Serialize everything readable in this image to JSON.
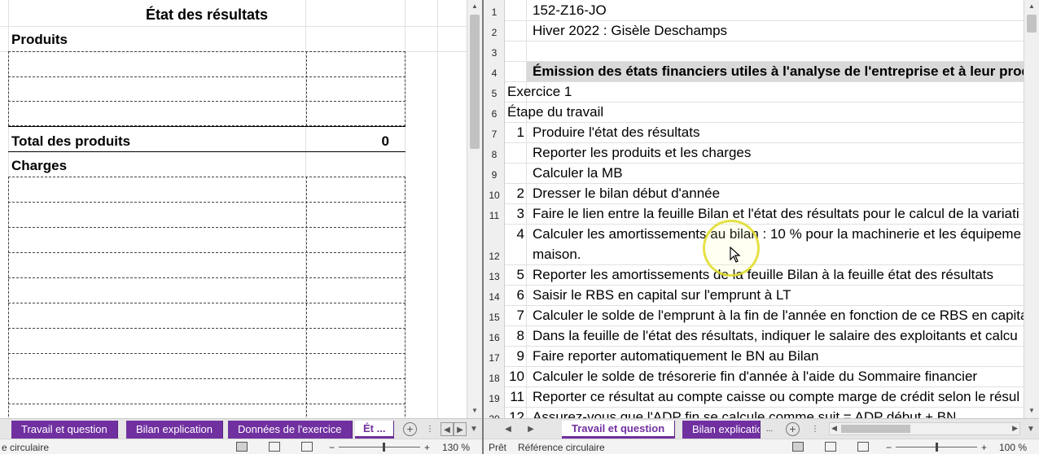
{
  "left": {
    "title": "État des résultats",
    "heading_products": "Produits",
    "total_label": "Total des produits",
    "total_value": "0",
    "heading_charges": "Charges"
  },
  "right": {
    "rows": [
      {
        "n": "1",
        "a": "",
        "b": "",
        "text": "152-Z16-JO"
      },
      {
        "n": "2",
        "a": "",
        "b": "",
        "text": "Hiver 2022 : Gisèle Deschamps"
      },
      {
        "n": "3",
        "a": "",
        "b": "",
        "text": ""
      },
      {
        "n": "4",
        "a": "",
        "b": "",
        "text": "Émission des états financiers utiles à l'analyse de l'entreprise et à leur produ"
      },
      {
        "n": "5",
        "a": "Exercice 1",
        "b": "",
        "text": ""
      },
      {
        "n": "6",
        "a": "Étape du travail",
        "b": "",
        "text": ""
      },
      {
        "n": "7",
        "a": "",
        "b": "1",
        "text": "Produire l'état des résultats"
      },
      {
        "n": "8",
        "a": "",
        "b": "",
        "text": "Reporter les produits et les charges"
      },
      {
        "n": "9",
        "a": "",
        "b": "",
        "text": "Calculer la MB"
      },
      {
        "n": "10",
        "a": "",
        "b": "2",
        "text": "Dresser le bilan début d'année"
      },
      {
        "n": "11",
        "a": "",
        "b": "3",
        "text": "Faire le lien entre la feuille Bilan et l'état des résultats pour le calcul de la variati"
      },
      {
        "n": "12",
        "a": "",
        "b": "4",
        "text": "Calculer les amortissements au bilan : 10 % pour la machinerie et les équipeme",
        "text2": "maison."
      },
      {
        "n": "13",
        "a": "",
        "b": "5",
        "text": "Reporter les amortissements de la feuille Bilan à la feuille état des résultats"
      },
      {
        "n": "14",
        "a": "",
        "b": "6",
        "text": "Saisir le RBS en capital sur l'emprunt à LT"
      },
      {
        "n": "15",
        "a": "",
        "b": "7",
        "text": "Calculer le solde de l'emprunt à la fin de l'année en fonction de ce RBS en capita"
      },
      {
        "n": "16",
        "a": "",
        "b": "8",
        "text": "Dans la feuille de l'état des résultats, indiquer le salaire des exploitants et calcu"
      },
      {
        "n": "17",
        "a": "",
        "b": "9",
        "text": "Faire reporter automatiquement le BN au Bilan"
      },
      {
        "n": "18",
        "a": "",
        "b": "10",
        "text": "Calculer le solde de trésorerie fin d'année à l'aide du Sommaire financier"
      },
      {
        "n": "19",
        "a": "",
        "b": "11",
        "text": "Reporter ce résultat au compte caisse ou compte marge de crédit selon le résul"
      },
      {
        "n": "20",
        "a": "",
        "b": "12",
        "text": "Assurez-vous que l'ADP fin se calcule comme suit = ADP début + BN"
      }
    ]
  },
  "tabs_left": [
    "Travail et question",
    "Bilan explication",
    "Données de l'exercice",
    "Ét"
  ],
  "tabs_left_more": "...",
  "tabs_right": [
    "Travail et question",
    "Bilan explication"
  ],
  "tabs_right_more": "...",
  "status_left": {
    "text": "e circulaire",
    "zoom": "130 %"
  },
  "status_right": {
    "ready": "Prêt",
    "text": "Référence circulaire",
    "zoom": "100 %"
  },
  "colors": {
    "tab": "#7030a0",
    "shade": "#d9d9d9"
  }
}
